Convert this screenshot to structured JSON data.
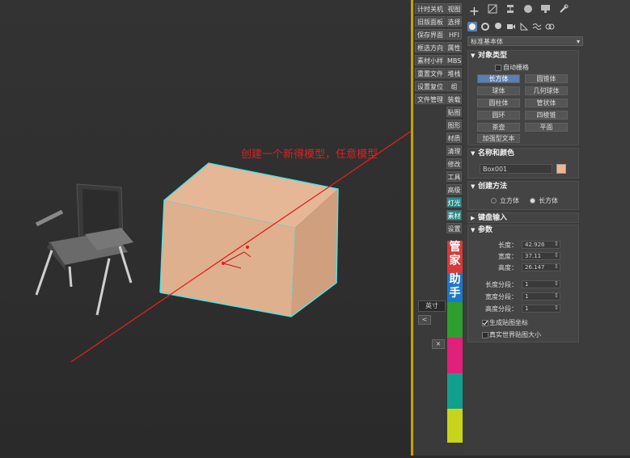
{
  "annotation": {
    "text": "创建一个新得模型，任意模型",
    "color": "#e02020"
  },
  "strip_buttons": [
    {
      "left": "计时关机",
      "right": "视图"
    },
    {
      "left": "旧版面板",
      "right": "选择"
    },
    {
      "left": "保存界面",
      "right": "HFI"
    },
    {
      "left": "框选方向",
      "right": "属性"
    },
    {
      "left": "素材小样",
      "right": "MBS"
    },
    {
      "left": "重置文件",
      "right": "堆栈"
    },
    {
      "left": "设置复位",
      "right": "组"
    },
    {
      "left": "文件管理",
      "right": "装载"
    }
  ],
  "strip_right_extra": [
    "贴图",
    "图形",
    "材质",
    "清理",
    "修改",
    "工具",
    "高级",
    "灯光",
    "素材",
    "设置"
  ],
  "strip_colorblocks": [
    {
      "text": "管家",
      "color": "#d63a3a"
    },
    {
      "text": "助手",
      "color": "#1e78c8"
    },
    {
      "text": "",
      "color": "#2e9e2e"
    },
    {
      "text": "",
      "color": "#e0207a"
    },
    {
      "text": "",
      "color": "#12a08e"
    },
    {
      "text": "",
      "color": "#c8d41c"
    }
  ],
  "units": {
    "label": "英寸",
    "back": "<",
    "close": "×"
  },
  "panel": {
    "create_tab_symbol": "+",
    "category_dropdown": "标准基本体",
    "object_type": {
      "title": "对象类型",
      "autogrid": "自动栅格",
      "buttons": [
        [
          "长方体",
          "圆锥体"
        ],
        [
          "球体",
          "几何球体"
        ],
        [
          "圆柱体",
          "管状体"
        ],
        [
          "圆环",
          "四棱锥"
        ],
        [
          "茶壶",
          "平面"
        ]
      ],
      "extra": "加强型文本"
    },
    "name_color": {
      "title": "名称和颜色",
      "name": "Box001",
      "swatch": "#f2b58c"
    },
    "creation": {
      "title": "创建方法",
      "opt1": "立方体",
      "opt2": "长方体"
    },
    "keyboard": {
      "title": "键盘输入"
    },
    "params": {
      "title": "参数",
      "length_label": "长度：",
      "length": "42.926",
      "width_label": "宽度：",
      "width": "37.11",
      "height_label": "高度：",
      "height": "26.147",
      "lseg_label": "长度分段：",
      "lseg": "1",
      "wseg_label": "宽度分段：",
      "wseg": "1",
      "hseg_label": "高度分段：",
      "hseg": "1",
      "gen_uv": "生成贴图坐标",
      "real_world": "真实世界贴图大小"
    }
  }
}
